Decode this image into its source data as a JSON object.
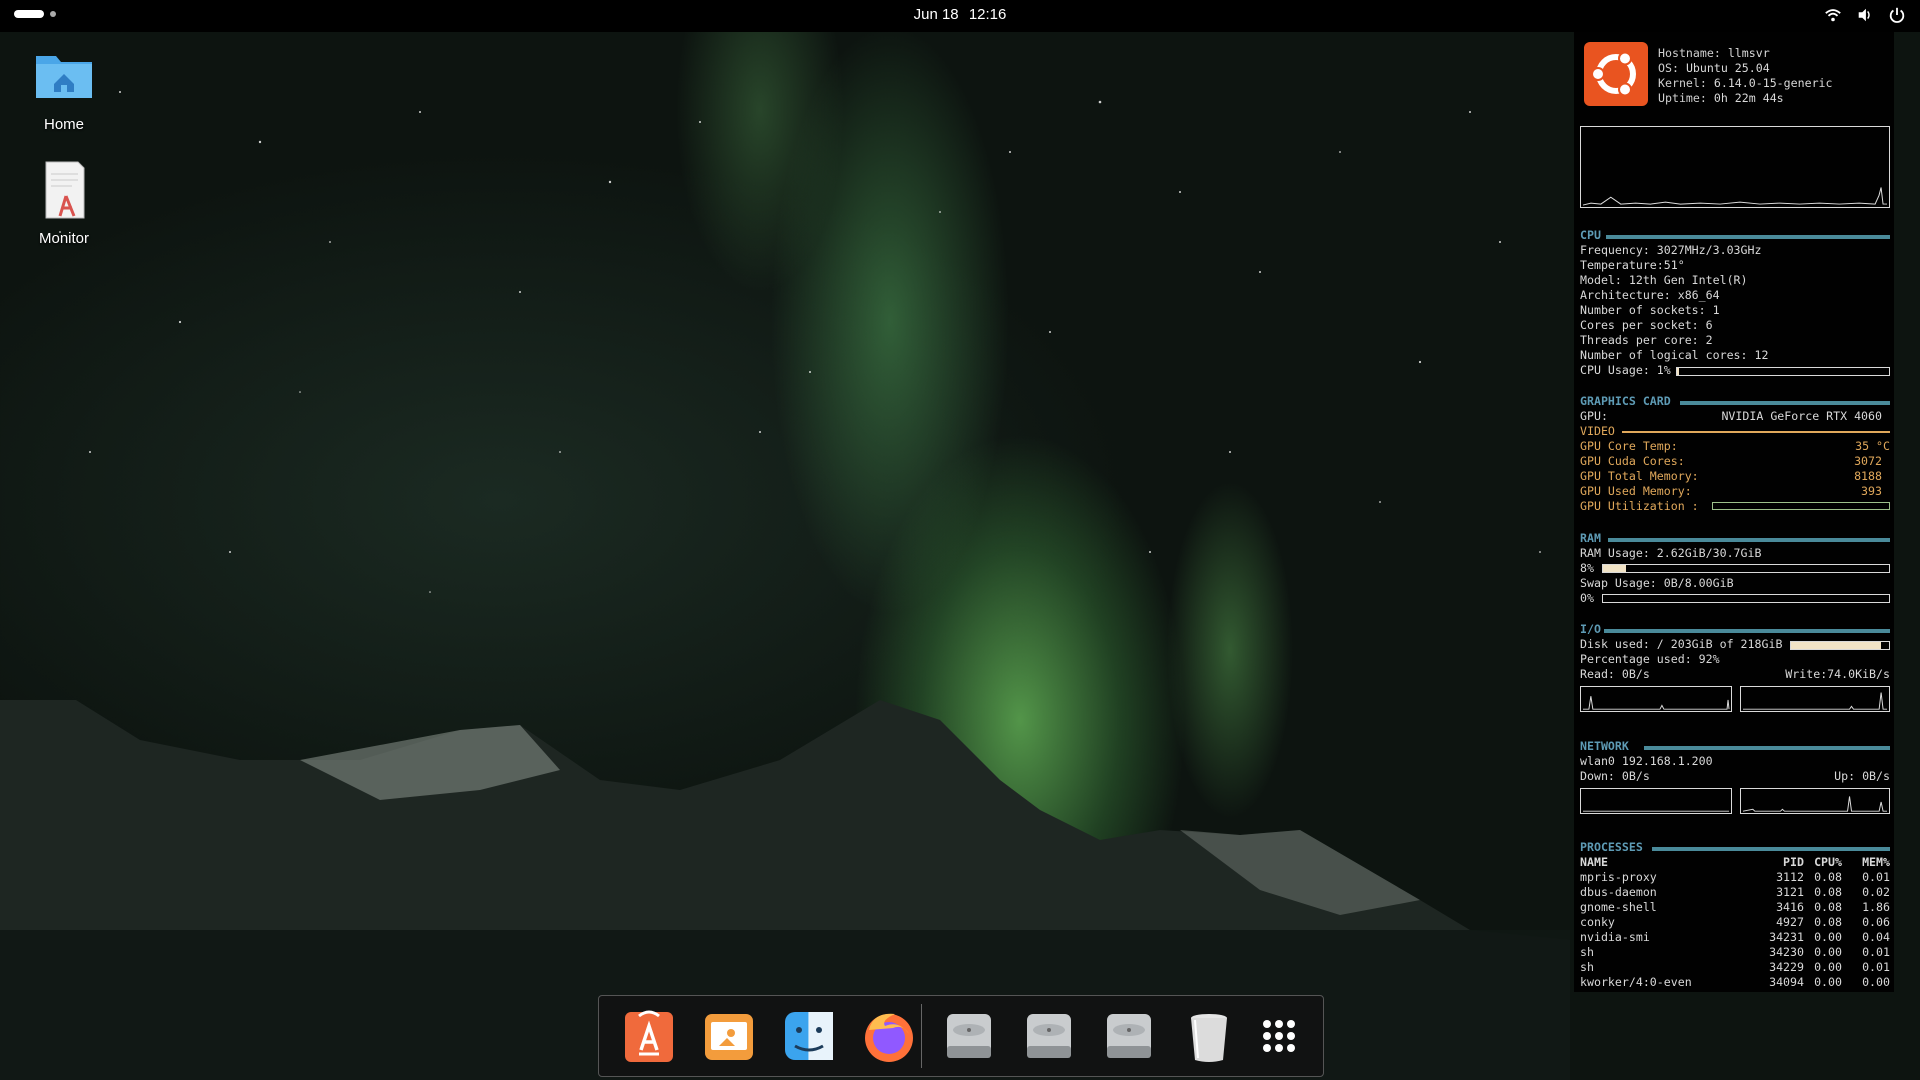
{
  "topbar": {
    "date": "Jun 18",
    "time": "12:16"
  },
  "desktop": {
    "icons": [
      {
        "label": "Home",
        "icon": "folder-home-icon"
      },
      {
        "label": "Monitor",
        "icon": "monitor-script-icon"
      }
    ]
  },
  "conky": {
    "system": {
      "hostname_label": "Hostname:",
      "hostname": "llmsvr",
      "os_label": "OS:",
      "os": "Ubuntu 25.04",
      "kernel_label": "Kernel:",
      "kernel": "6.14.0-15-generic",
      "uptime_label": "Uptime:",
      "uptime": "0h 22m 44s"
    },
    "cpu": {
      "title": "CPU",
      "frequency": "Frequency: 3027MHz/3.03GHz",
      "temperature": "Temperature:51°",
      "model": "Model: 12th Gen Intel(R)",
      "architecture": "Architecture: x86_64",
      "sockets": "Number of sockets: 1",
      "cores": "Cores per socket: 6",
      "threads": "Threads per core: 2",
      "logical": "Number of logical cores: 12",
      "usage_label": "CPU Usage: 1%",
      "usage_fraction": 0.01
    },
    "gpu": {
      "title": "GRAPHICS CARD",
      "gpu_label": "GPU:",
      "gpu_name": "NVIDIA GeForce RTX 4060",
      "video_title": "VIDEO",
      "rows": [
        {
          "label": "GPU Core Temp:",
          "value": "35 °C"
        },
        {
          "label": "GPU Cuda Cores:",
          "value": "3072"
        },
        {
          "label": "GPU Total Memory:",
          "value": "8188"
        },
        {
          "label": "GPU Used Memory:",
          "value": "393"
        }
      ],
      "util_label": "GPU Utilization :",
      "util_fraction": 0.0
    },
    "ram": {
      "title": "RAM",
      "usage": "RAM Usage: 2.62GiB/30.7GiB",
      "usage_pct": "8%",
      "usage_fraction": 0.08,
      "swap": "Swap Usage: 0B/8.00GiB",
      "swap_pct": "0%",
      "swap_fraction": 0.0
    },
    "io": {
      "title": "I/O",
      "disk": "Disk used: / 203GiB of 218GiB",
      "disk_fraction": 0.92,
      "pct": "Percentage used: 92%",
      "read": "Read: 0B/s",
      "write": "Write:74.0KiB/s"
    },
    "network": {
      "title": "NETWORK",
      "iface": "wlan0 192.168.1.200",
      "down": "Down: 0B/s",
      "up": "Up: 0B/s"
    },
    "processes": {
      "title": "PROCESSES",
      "headers": [
        "NAME",
        "PID",
        "CPU%",
        "MEM%"
      ],
      "rows": [
        [
          "mpris-proxy",
          "3112",
          "0.08",
          "0.01"
        ],
        [
          "dbus-daemon",
          "3121",
          "0.08",
          "0.02"
        ],
        [
          "gnome-shell",
          "3416",
          "0.08",
          "1.86"
        ],
        [
          "conky",
          "4927",
          "0.08",
          "0.06"
        ],
        [
          "nvidia-smi",
          "34231",
          "0.00",
          "0.04"
        ],
        [
          "sh",
          "34230",
          "0.00",
          "0.01"
        ],
        [
          "sh",
          "34229",
          "0.00",
          "0.01"
        ],
        [
          "kworker/4:0-even",
          "34094",
          "0.00",
          "0.00"
        ]
      ]
    }
  },
  "dock": {
    "items": [
      "app-store-icon",
      "presentation-icon",
      "finder-icon",
      "firefox-icon",
      "drive-icon",
      "drive-icon",
      "drive-icon",
      "trash-icon",
      "app-grid-icon"
    ]
  },
  "colors": {
    "conky_section": "#5e9bb5",
    "gpu_text": "#e0a85b",
    "ubuntu_orange": "#e95420"
  }
}
